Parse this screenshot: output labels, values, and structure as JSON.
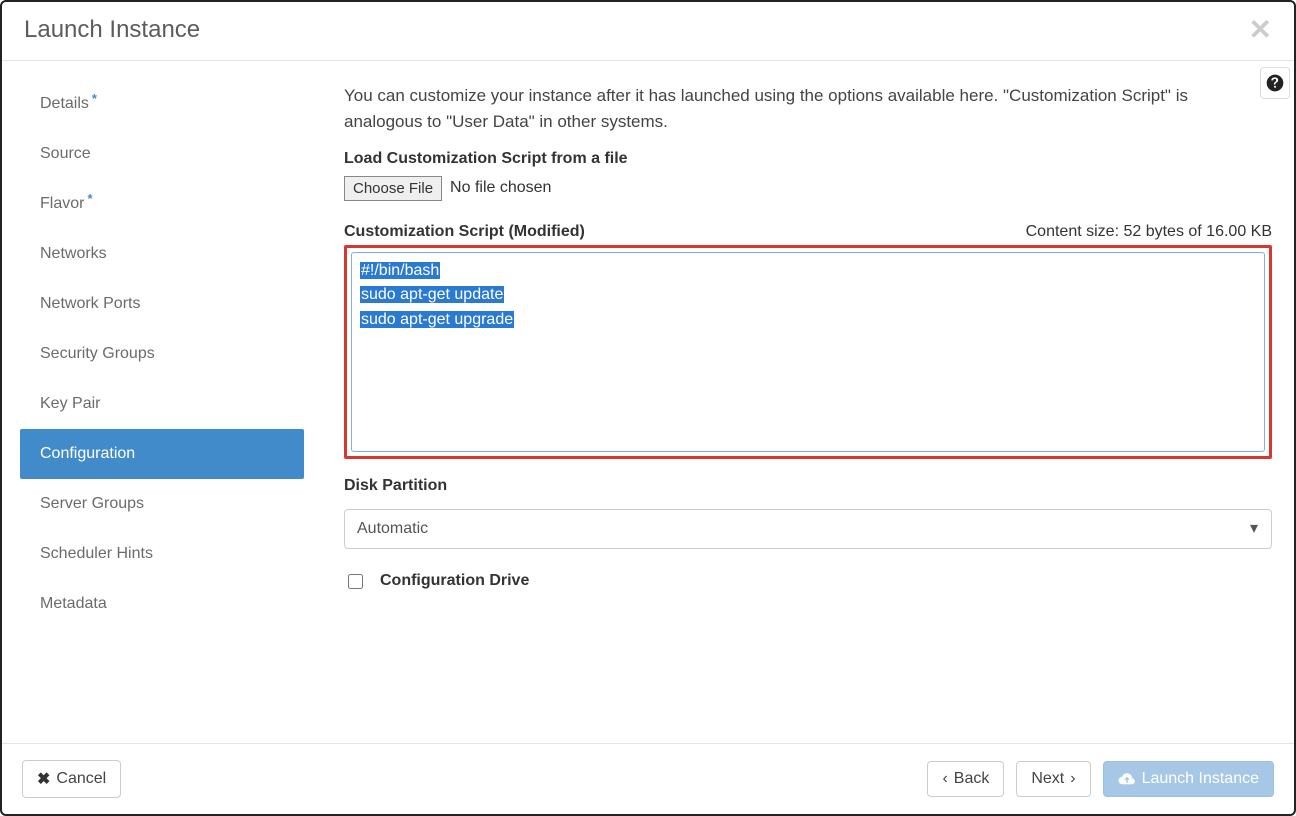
{
  "header": {
    "title": "Launch Instance"
  },
  "sidebar": {
    "items": [
      {
        "label": "Details",
        "starred": true,
        "active": false
      },
      {
        "label": "Source",
        "starred": false,
        "active": false
      },
      {
        "label": "Flavor",
        "starred": true,
        "active": false
      },
      {
        "label": "Networks",
        "starred": false,
        "active": false
      },
      {
        "label": "Network Ports",
        "starred": false,
        "active": false
      },
      {
        "label": "Security Groups",
        "starred": false,
        "active": false
      },
      {
        "label": "Key Pair",
        "starred": false,
        "active": false
      },
      {
        "label": "Configuration",
        "starred": false,
        "active": true
      },
      {
        "label": "Server Groups",
        "starred": false,
        "active": false
      },
      {
        "label": "Scheduler Hints",
        "starred": false,
        "active": false
      },
      {
        "label": "Metadata",
        "starred": false,
        "active": false
      }
    ]
  },
  "main": {
    "intro": "You can customize your instance after it has launched using the options available here. \"Customization Script\" is analogous to \"User Data\" in other systems.",
    "load_script_label": "Load Customization Script from a file",
    "choose_file_label": "Choose File",
    "file_status": "No file chosen",
    "script_label": "Customization Script (Modified)",
    "content_size": "Content size: 52 bytes of 16.00 KB",
    "script_lines": [
      "#!/bin/bash",
      "sudo apt-get update",
      "sudo apt-get upgrade"
    ],
    "disk_partition_label": "Disk Partition",
    "disk_partition_value": "Automatic",
    "config_drive_label": "Configuration Drive",
    "config_drive_checked": false
  },
  "footer": {
    "cancel": "Cancel",
    "back": "Back",
    "next": "Next",
    "launch": "Launch Instance"
  }
}
